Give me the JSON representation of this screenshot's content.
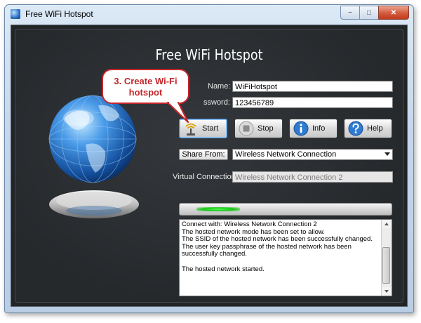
{
  "window": {
    "title": "Free WiFi Hotspot",
    "caption": {
      "minimize": "−",
      "maximize": "□",
      "close": "✕"
    }
  },
  "app": {
    "heading": "Free WiFi Hotspot"
  },
  "callout": {
    "line1": "3. Create Wi-Fi",
    "line2": "hotspot"
  },
  "form": {
    "name_label": "Name:",
    "name_value": "WiFiHotspot",
    "password_label": "ssword:",
    "password_value": "123456789",
    "share_from_label": "Share From:",
    "share_from_value": "Wireless Network Connection",
    "virtual_label": "Virtual Connection:",
    "virtual_value": "Wireless Network Connection 2"
  },
  "buttons": {
    "start": "Start",
    "stop": "Stop",
    "info": "Info",
    "help": "Help"
  },
  "progress": {
    "active": true
  },
  "log": {
    "text": "Connect with: Wireless Network Connection 2\nThe hosted network mode has been set to allow.\nThe SSID of the hosted network has been successfully changed.\nThe user key passphrase of the hosted network has been successfully changed.\n\nThe hosted network started."
  },
  "icons": {
    "app": "globe-icon",
    "start": "wifi-antenna-icon",
    "stop": "stop-icon",
    "info": "info-icon",
    "help": "help-icon",
    "logo": "globe-logo"
  },
  "colors": {
    "background": "#26292c",
    "callout_red": "#c4262b",
    "progress_green": "#18c518",
    "icon_blue": "#2f7ad1"
  }
}
